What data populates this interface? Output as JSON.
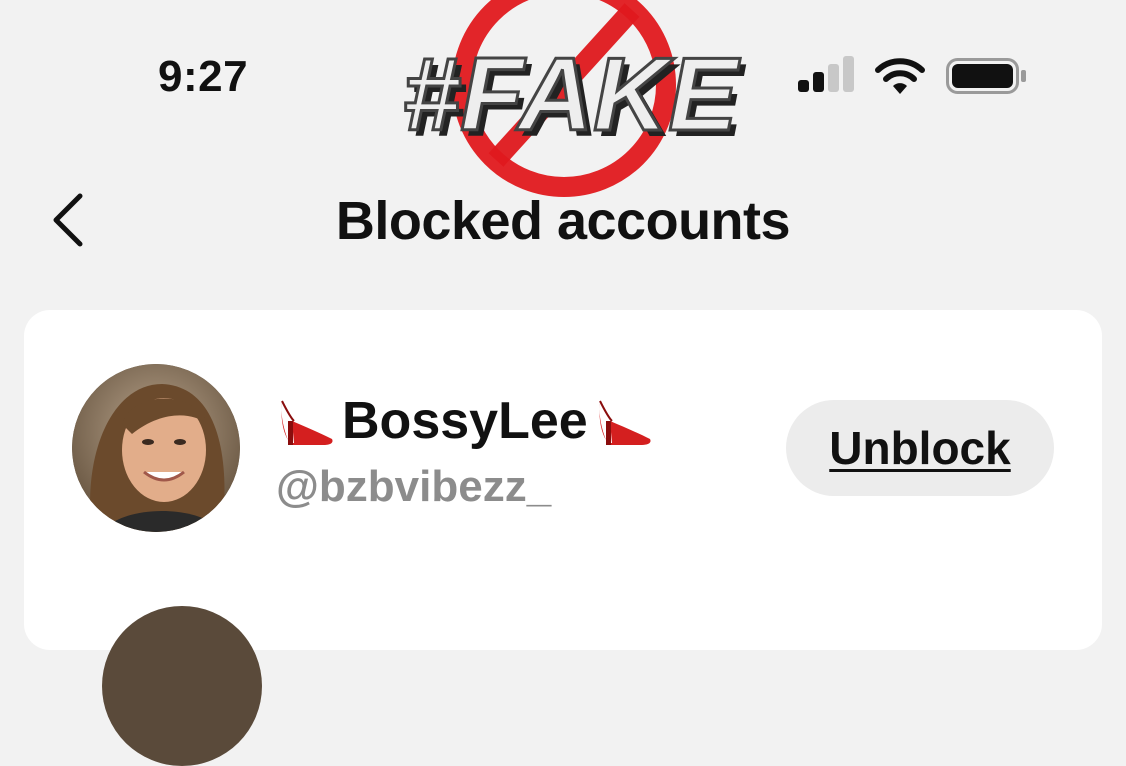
{
  "status_bar": {
    "time": "9:27",
    "icons": [
      "signal-icon",
      "wifi-icon",
      "battery-icon"
    ]
  },
  "watermark": {
    "text": "#FAKE",
    "icon": "prohibited-icon",
    "color": "#e0191e"
  },
  "header": {
    "back_icon": "chevron-left-icon",
    "title": "Blocked accounts"
  },
  "blocked_accounts": [
    {
      "display_name": "BossyLee",
      "name_icon": "high-heel-icon",
      "handle": "@bzbvibezz_",
      "action_label": "Unblock"
    }
  ],
  "colors": {
    "background": "#f2f2f2",
    "card": "#ffffff",
    "text": "#111111",
    "secondary_text": "#8c8c8c",
    "button_bg": "#ececec"
  }
}
